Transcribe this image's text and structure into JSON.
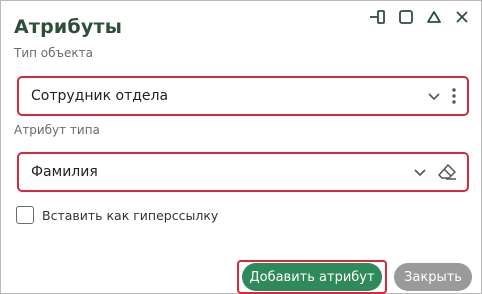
{
  "dialog": {
    "title": "Атрибуты"
  },
  "object_type": {
    "label": "Тип объекта",
    "value": "Сотрудник отдела"
  },
  "attribute_type": {
    "label": "Атрибут типа",
    "value": "Фамилия"
  },
  "hyperlink_checkbox": {
    "label": "Вставить как гиперссылку",
    "checked": false
  },
  "buttons": {
    "add": "Добавить атрибут",
    "close": "Закрыть"
  },
  "colors": {
    "title": "#2c4f3a",
    "accent_green": "#2e8a5a",
    "highlight_red": "#d6293b",
    "close_gray": "#9a9a9a"
  },
  "icons": {
    "window": [
      "dock-icon",
      "maximize-icon",
      "minimize-icon",
      "close-icon"
    ],
    "object_type": [
      "chevron-down-icon",
      "more-vertical-icon"
    ],
    "attribute_type": [
      "chevron-down-icon",
      "eraser-icon"
    ]
  }
}
